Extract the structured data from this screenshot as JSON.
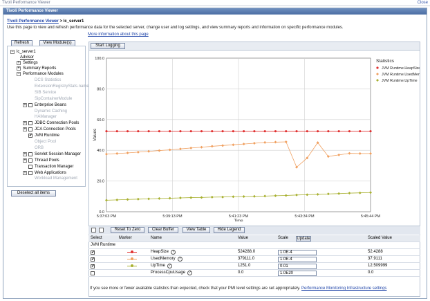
{
  "window": {
    "title": "Tivoli Performance Viewer",
    "close_label": "Close"
  },
  "portlet": {
    "title": "Tivoli Performance Viewer"
  },
  "breadcrumb": {
    "root": "Tivoli Performance Viewer",
    "sep": " > ",
    "current": "lc_server1"
  },
  "intro_text": "Use this page to view and refresh performance data for the selected server, change user and log settings, and view summary reports and information on specific performance modules.",
  "more_info": "More information about this page",
  "buttons": {
    "refresh": "Refresh",
    "view_modules": "View Module(s)",
    "start_logging": "Start Logging",
    "deselect_all": "Deselect all items",
    "reset_to_zero": "Reset To Zero",
    "clear_buffer": "Clear Buffer",
    "view_table": "View Table",
    "hide_legend": "Hide Legend",
    "update": "Update"
  },
  "tree": {
    "root": "lc_server1",
    "advisor": "Advisor",
    "settings": "Settings",
    "summary_reports": "Summary Reports",
    "performance_modules": "Performance Modules",
    "modules": [
      {
        "label": "DCS Statistics",
        "enabled": false,
        "checked": false,
        "expandable": false
      },
      {
        "label": "ExtensionRegistryStats.name",
        "enabled": false,
        "checked": false,
        "expandable": false
      },
      {
        "label": "SIB Service",
        "enabled": false,
        "checked": false,
        "expandable": false
      },
      {
        "label": "SipContainerModule",
        "enabled": false,
        "checked": false,
        "expandable": false
      },
      {
        "label": "Enterprise Beans",
        "enabled": true,
        "checked": false,
        "expandable": true
      },
      {
        "label": "Dynamic Caching",
        "enabled": false,
        "checked": false,
        "expandable": false
      },
      {
        "label": "HAManager",
        "enabled": false,
        "checked": false,
        "expandable": false
      },
      {
        "label": "JDBC Connection Pools",
        "enabled": true,
        "checked": false,
        "expandable": true
      },
      {
        "label": "JCA Connection Pools",
        "enabled": true,
        "checked": false,
        "expandable": true
      },
      {
        "label": "JVM Runtime",
        "enabled": true,
        "checked": true,
        "expandable": false
      },
      {
        "label": "Object Pool",
        "enabled": false,
        "checked": false,
        "expandable": false
      },
      {
        "label": "ORB",
        "enabled": false,
        "checked": false,
        "expandable": false
      },
      {
        "label": "Servlet Session Manager",
        "enabled": true,
        "checked": false,
        "expandable": true
      },
      {
        "label": "Thread Pools",
        "enabled": true,
        "checked": false,
        "expandable": true
      },
      {
        "label": "Transaction Manager",
        "enabled": true,
        "checked": false,
        "expandable": false
      },
      {
        "label": "Web Applications",
        "enabled": true,
        "checked": false,
        "expandable": true
      },
      {
        "label": "Workload Management",
        "enabled": false,
        "checked": false,
        "expandable": false
      }
    ]
  },
  "chart_data": {
    "type": "line",
    "title": "",
    "xlabel": "Time",
    "ylabel": "Values",
    "ylim": [
      0,
      100
    ],
    "yticks": [
      "0.0",
      "20.0",
      "40.0",
      "60.0",
      "80.0",
      "100.0"
    ],
    "xticks": [
      "5:37:03 PM",
      "5:39:13 PM",
      "5:41:23 PM",
      "5:43:34 PM",
      "5:45:44 PM"
    ],
    "grid": true,
    "legend_title": "Statistics",
    "legend_position": "right",
    "n_points": 26,
    "series": [
      {
        "name": "JVM Runtime.HeapSize",
        "color": "#e03030",
        "marker": "dot",
        "values": [
          52.4,
          52.4,
          52.4,
          52.4,
          52.4,
          52.4,
          52.4,
          52.4,
          52.4,
          52.4,
          52.4,
          52.4,
          52.4,
          52.4,
          52.4,
          52.4,
          52.4,
          52.4,
          52.4,
          52.4,
          52.4,
          52.4,
          52.4,
          52.4,
          52.4,
          52.4
        ]
      },
      {
        "name": "JVM Runtime.UsedMemory",
        "color": "#f0a060",
        "marker": "diamond",
        "values": [
          37.5,
          37.9,
          38.3,
          38.8,
          39.3,
          39.8,
          40.3,
          40.9,
          41.5,
          42.0,
          42.6,
          43.1,
          43.6,
          44.1,
          44.6,
          45.1,
          45.3,
          45.5,
          29.0,
          35.0,
          45.0,
          36.0,
          37.0,
          38.0,
          37.9,
          37.9
        ]
      },
      {
        "name": "JVM Runtime.UpTime",
        "color": "#a8b030",
        "marker": "diamond",
        "values": [
          7.5,
          7.7,
          8.0,
          8.2,
          8.4,
          8.6,
          8.8,
          9.0,
          9.2,
          9.3,
          9.5,
          9.6,
          9.8,
          9.9,
          10.0,
          10.2,
          10.4,
          10.6,
          10.9,
          11.1,
          11.3,
          11.6,
          11.8,
          12.1,
          12.3,
          12.5
        ]
      }
    ]
  },
  "table": {
    "headers": {
      "select": "Select",
      "marker": "Marker",
      "name": "Name",
      "value": "Value",
      "scale": "Scale",
      "scaled": "Scaled Value"
    },
    "group": "JVM Runtime",
    "rows": [
      {
        "checked": true,
        "marker_color": "#e03030",
        "name": "HeapSize",
        "value": "524288.0",
        "scale": "1.0E-4",
        "scaled": "52.4288"
      },
      {
        "checked": true,
        "marker_color": "#f0a060",
        "name": "UsedMemory",
        "value": "379111.0",
        "scale": "1.0E-4",
        "scaled": "37.9111"
      },
      {
        "checked": true,
        "marker_color": "#a8b030",
        "name": "UpTime",
        "value": "1251.0",
        "scale": "0.01",
        "scaled": "12.509999"
      },
      {
        "checked": false,
        "marker_color": "",
        "name": "ProcessCpuUsage",
        "value": "0.0",
        "scale": "1.0E20",
        "scaled": "0.0"
      }
    ]
  },
  "footer": {
    "text": "If you see more or fewer available statistics than expected, check that your PMI level settings are set appropriately.",
    "link": "Performance Monitoring Infrastructure settings"
  }
}
